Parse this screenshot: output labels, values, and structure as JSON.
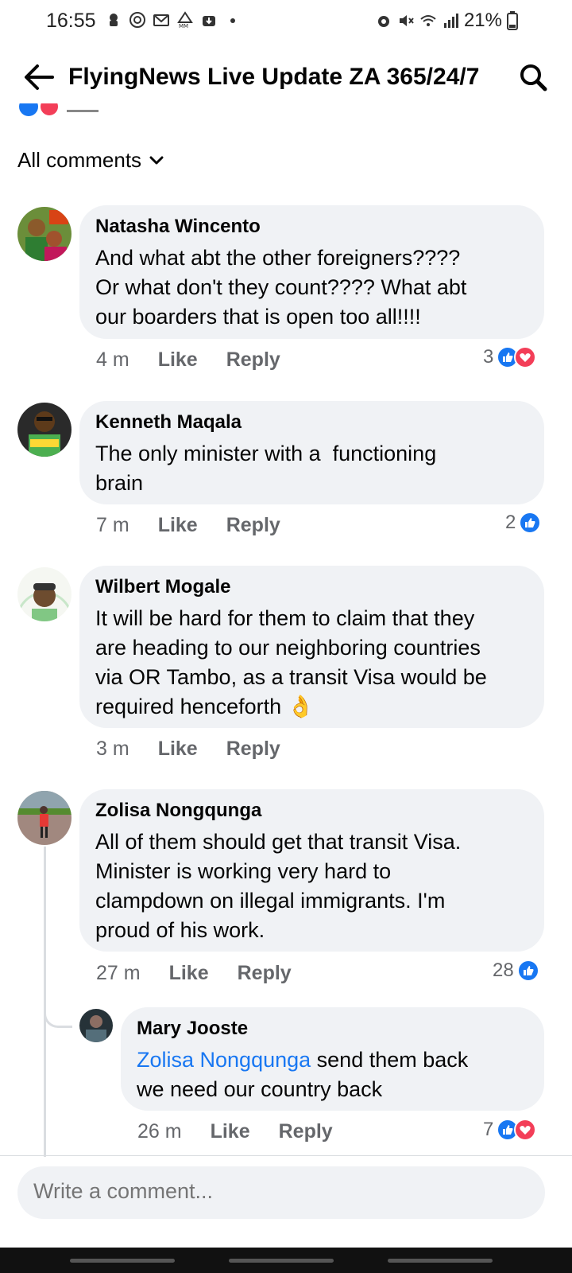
{
  "status_bar": {
    "time": "16:55",
    "battery": "21%",
    "left_icons": [
      "notification-icon",
      "target-icon",
      "gmail-icon",
      "mm-icon",
      "download-icon",
      "dot-icon"
    ],
    "right_icons": [
      "alarm-icon",
      "mute-icon",
      "wifi-icon",
      "signal-icon",
      "battery-icon"
    ]
  },
  "header": {
    "title": "FlyingNews Live Update ZA 365/24/7"
  },
  "sort": {
    "label": "All comments"
  },
  "comments": [
    {
      "name": "Natasha Wincento",
      "lines": [
        "And what abt the other foreigners????",
        "Or what don't they count???? What abt",
        "our boarders that is open too all!!!!"
      ],
      "time": "4 m",
      "like": "Like",
      "reply": "Reply",
      "reactions": "3",
      "reaction_types": [
        "like",
        "love"
      ]
    },
    {
      "name": "Kenneth Maqala",
      "lines": [
        "The only minister with a  functioning",
        "brain"
      ],
      "time": "7 m",
      "like": "Like",
      "reply": "Reply",
      "reactions": "2",
      "reaction_types": [
        "like"
      ]
    },
    {
      "name": "Wilbert Mogale",
      "lines": [
        "It will be hard for them to claim that they",
        "are heading to our neighboring countries",
        "via OR Tambo, as a transit Visa would be",
        "required henceforth 👌"
      ],
      "time": "3 m",
      "like": "Like",
      "reply": "Reply",
      "reactions": "",
      "reaction_types": []
    },
    {
      "name": "Zolisa Nongqunga",
      "lines": [
        "All of them should get that transit Visa.",
        "Minister is working very hard to",
        "clampdown on illegal immigrants. I'm",
        "proud of his work."
      ],
      "time": "27 m",
      "like": "Like",
      "reply": "Reply",
      "reactions": "28",
      "reaction_types": [
        "like"
      ]
    }
  ],
  "reply": {
    "name": "Mary Jooste",
    "mention": "Zolisa Nongqunga",
    "line1_rest": " send them back",
    "line2": "we need our country back",
    "time": "26 m",
    "like": "Like",
    "reply": "Reply",
    "reactions": "7",
    "reaction_types": [
      "like",
      "love"
    ]
  },
  "composer": {
    "placeholder": "Write a comment..."
  },
  "colors": {
    "accent": "#1877f2",
    "love": "#f33e58",
    "bubble": "#f0f2f5",
    "meta": "#65676b"
  }
}
